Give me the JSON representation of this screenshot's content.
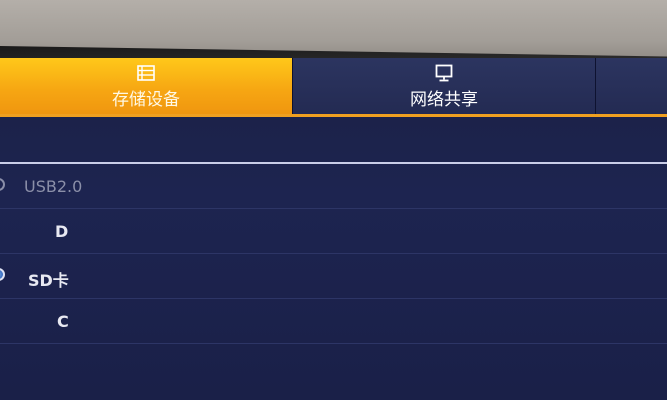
{
  "tabs": [
    {
      "label": "存储设备",
      "icon": "list-icon",
      "active": true
    },
    {
      "label": "网络共享",
      "icon": "monitor-icon",
      "active": false
    }
  ],
  "colors": {
    "active_tab": "#f6a512",
    "tab_underline": "#f0a020",
    "background": "#1d2450"
  },
  "devices": [
    {
      "label": "USB2.0",
      "type": "device",
      "state": "dimmed"
    },
    {
      "label": "D",
      "type": "partition"
    },
    {
      "label": "SD卡",
      "type": "device",
      "state": "selected"
    },
    {
      "label": "C",
      "type": "partition"
    }
  ]
}
